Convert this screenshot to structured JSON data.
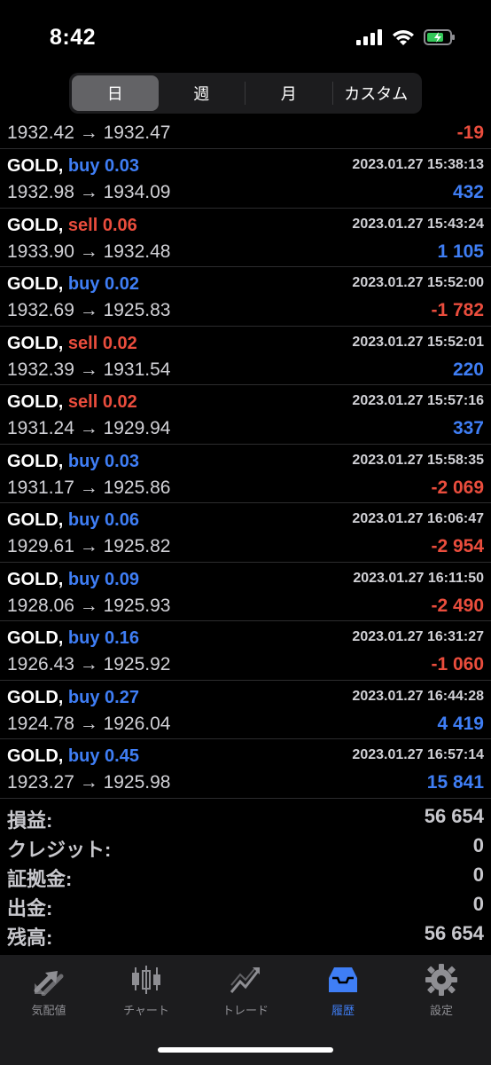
{
  "status": {
    "time": "8:42"
  },
  "segments": [
    "日",
    "週",
    "月",
    "カスタム"
  ],
  "first_row": {
    "prices": "1932.42 → 1932.47",
    "profit": "-19",
    "profit_sign": "neg"
  },
  "trades": [
    {
      "symbol": "GOLD,",
      "side": "buy",
      "volume": "buy 0.03",
      "time": "2023.01.27 15:38:13",
      "prices": "1932.98 → 1934.09",
      "profit": "432",
      "profit_sign": "pos"
    },
    {
      "symbol": "GOLD,",
      "side": "sell",
      "volume": "sell 0.06",
      "time": "2023.01.27 15:43:24",
      "prices": "1933.90 → 1932.48",
      "profit": "1 105",
      "profit_sign": "pos"
    },
    {
      "symbol": "GOLD,",
      "side": "buy",
      "volume": "buy 0.02",
      "time": "2023.01.27 15:52:00",
      "prices": "1932.69 → 1925.83",
      "profit": "-1 782",
      "profit_sign": "neg"
    },
    {
      "symbol": "GOLD,",
      "side": "sell",
      "volume": "sell 0.02",
      "time": "2023.01.27 15:52:01",
      "prices": "1932.39 → 1931.54",
      "profit": "220",
      "profit_sign": "pos"
    },
    {
      "symbol": "GOLD,",
      "side": "sell",
      "volume": "sell 0.02",
      "time": "2023.01.27 15:57:16",
      "prices": "1931.24 → 1929.94",
      "profit": "337",
      "profit_sign": "pos"
    },
    {
      "symbol": "GOLD,",
      "side": "buy",
      "volume": "buy 0.03",
      "time": "2023.01.27 15:58:35",
      "prices": "1931.17 → 1925.86",
      "profit": "-2 069",
      "profit_sign": "neg"
    },
    {
      "symbol": "GOLD,",
      "side": "buy",
      "volume": "buy 0.06",
      "time": "2023.01.27 16:06:47",
      "prices": "1929.61 → 1925.82",
      "profit": "-2 954",
      "profit_sign": "neg"
    },
    {
      "symbol": "GOLD,",
      "side": "buy",
      "volume": "buy 0.09",
      "time": "2023.01.27 16:11:50",
      "prices": "1928.06 → 1925.93",
      "profit": "-2 490",
      "profit_sign": "neg"
    },
    {
      "symbol": "GOLD,",
      "side": "buy",
      "volume": "buy 0.16",
      "time": "2023.01.27 16:31:27",
      "prices": "1926.43 → 1925.92",
      "profit": "-1 060",
      "profit_sign": "neg"
    },
    {
      "symbol": "GOLD,",
      "side": "buy",
      "volume": "buy 0.27",
      "time": "2023.01.27 16:44:28",
      "prices": "1924.78 → 1926.04",
      "profit": "4 419",
      "profit_sign": "pos"
    },
    {
      "symbol": "GOLD,",
      "side": "buy",
      "volume": "buy 0.45",
      "time": "2023.01.27 16:57:14",
      "prices": "1923.27 → 1925.98",
      "profit": "15 841",
      "profit_sign": "pos"
    }
  ],
  "summary": [
    {
      "label": "損益:",
      "value": "56 654"
    },
    {
      "label": "クレジット:",
      "value": "0"
    },
    {
      "label": "証拠金:",
      "value": "0"
    },
    {
      "label": "出金:",
      "value": "0"
    },
    {
      "label": "残高:",
      "value": "56 654"
    }
  ],
  "tabs": [
    {
      "label": "気配値",
      "icon": "quotes-arrows-icon",
      "active": false
    },
    {
      "label": "チャート",
      "icon": "candlestick-chart-icon",
      "active": false
    },
    {
      "label": "トレード",
      "icon": "trade-line-icon",
      "active": false
    },
    {
      "label": "履歴",
      "icon": "history-inbox-icon",
      "active": true
    },
    {
      "label": "設定",
      "icon": "gear-icon",
      "active": false
    }
  ],
  "colors": {
    "buy": "#3f7ef5",
    "sell": "#ea4d3d",
    "active_tab": "#3f7ef5",
    "inactive_tab": "#8e8e93"
  }
}
